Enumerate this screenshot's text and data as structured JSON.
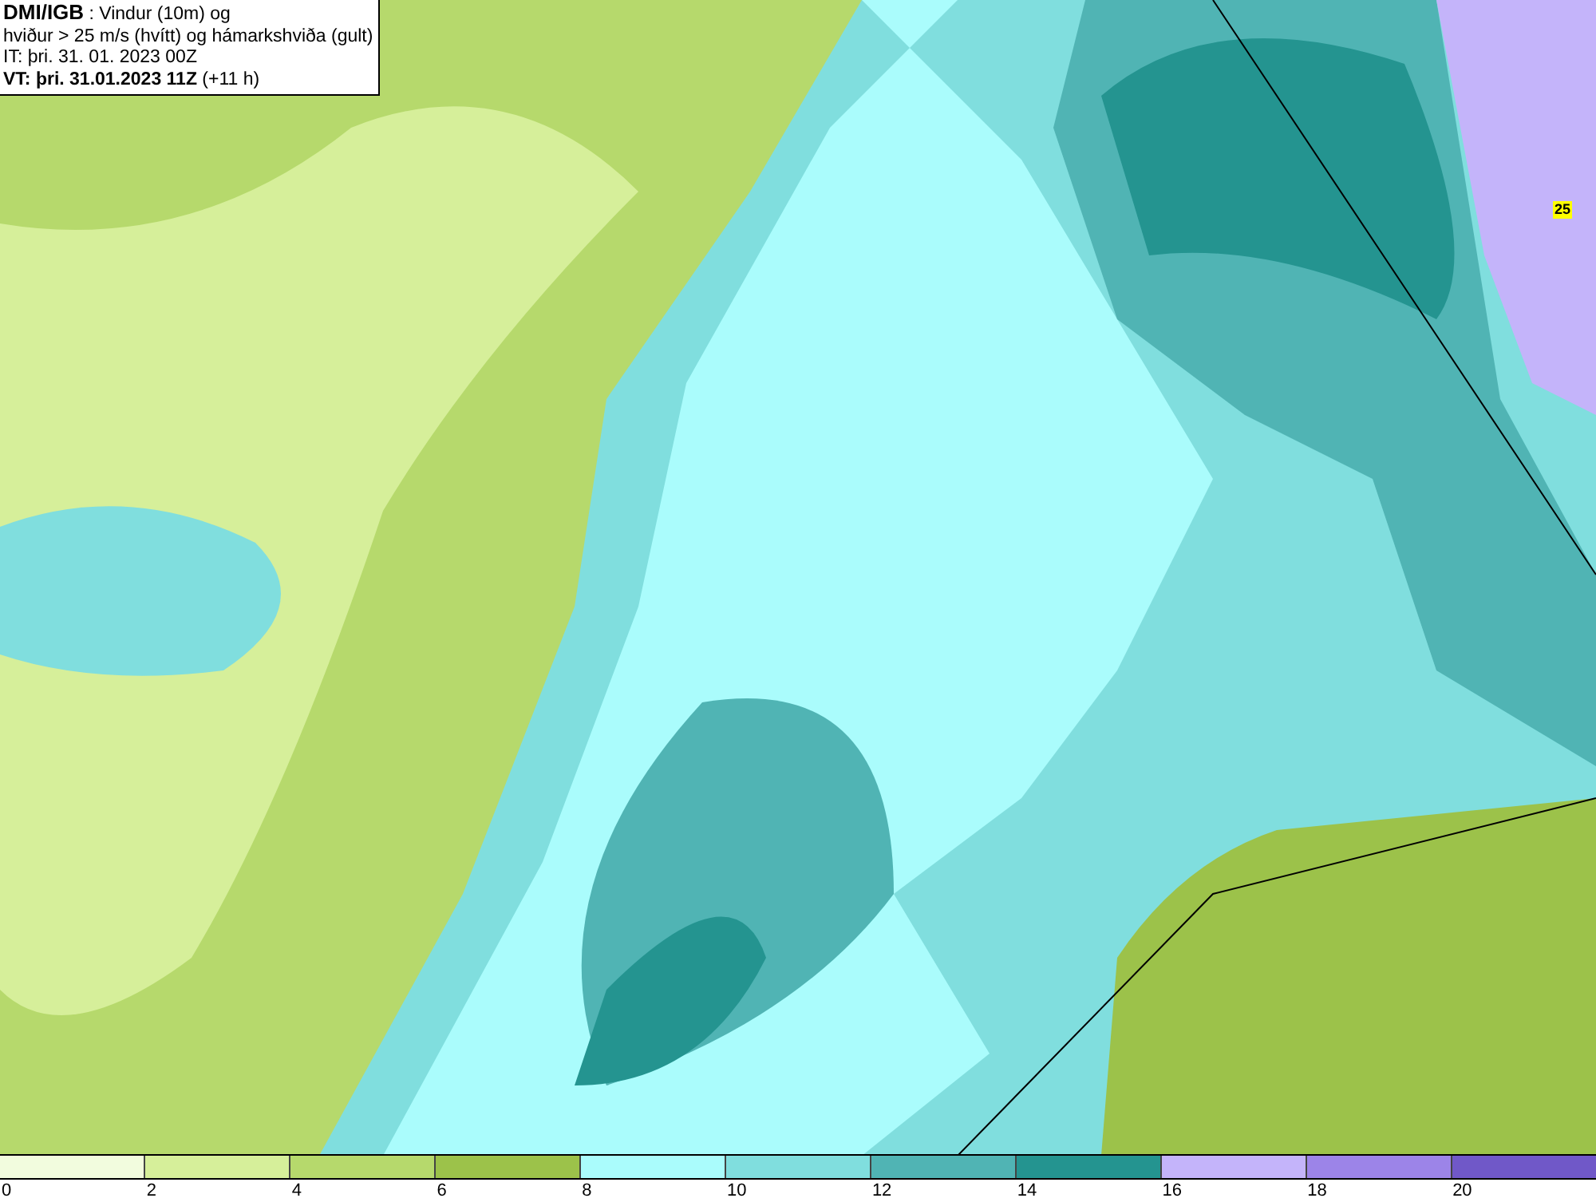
{
  "legend": {
    "lines": [
      "**DMI/IGB** : Vindur (10m) og",
      "hviður > 25 m/s (hvítt) og hámarkshviða (gult)",
      "IT: þri. 31. 01. 2023 00Z",
      "**VT: þri. 31.01.2023 11Z** (+11 h)"
    ]
  },
  "map": {
    "gust_label": "25"
  },
  "colorbar": {
    "bins": [
      {
        "color": "#f2fcde"
      },
      {
        "color": "#d6ef9a"
      },
      {
        "color": "#b6d96c"
      },
      {
        "color": "#9cc24a"
      },
      {
        "color": "#aafcfc"
      },
      {
        "color": "#80dede"
      },
      {
        "color": "#50b4b4"
      },
      {
        "color": "#249490"
      },
      {
        "color": "#c4b4fa"
      },
      {
        "color": "#9c84e8"
      },
      {
        "color": "#7058c8"
      }
    ],
    "ticks": [
      "0",
      "2",
      "4",
      "6",
      "8",
      "10",
      "12",
      "14",
      "16",
      "18",
      "20"
    ]
  }
}
